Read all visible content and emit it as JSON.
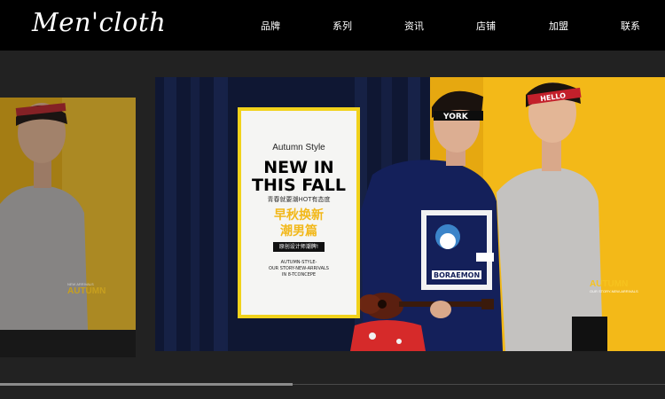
{
  "header": {
    "logo": "Men'cloth",
    "nav": [
      "品牌",
      "系列",
      "资讯",
      "店铺",
      "加盟",
      "联系"
    ]
  },
  "poster": {
    "style_line": "Autumn Style",
    "headline_1": "NEW IN",
    "headline_2": "THIS FALL",
    "sub": "青春就要潮HOT有态度",
    "cn_1": "早秋换新",
    "cn_2": "潮男篇",
    "badge": "原创设计师潮牌!",
    "small_1": "AUTUMN-STYLE-",
    "small_2": "OUR STORY-NEW-ARRIVALS",
    "small_3": "IN 8-TCONCEPE"
  },
  "captions": {
    "left_tag": "NEW ARRIVALS",
    "left_title": "AUTUMN",
    "right_title": "AUTUMN"
  },
  "models": {
    "headband_right": "HELLO",
    "headband_center": "YORK",
    "shirt_print": "BORAEMON"
  },
  "colors": {
    "header_bg": "#000000",
    "page_bg": "#222222",
    "accent_yellow": "#f6c31e"
  }
}
